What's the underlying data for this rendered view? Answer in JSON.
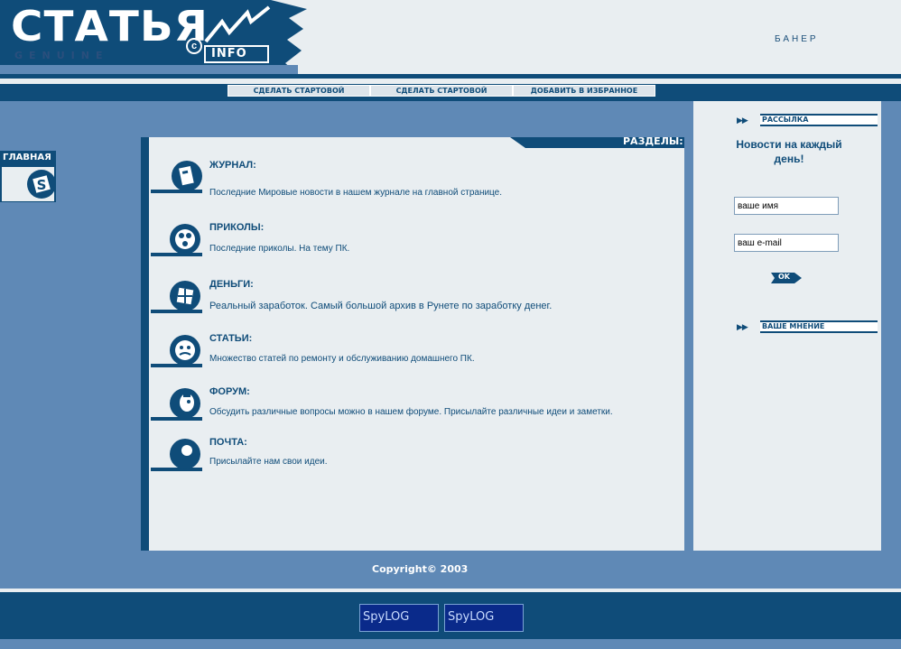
{
  "header": {
    "logo_text": "СТАТЬЯ",
    "logo_subtext": "GENUINE",
    "logo_copyright": "c",
    "logo_info": "INFO",
    "banner": "БАНЕР"
  },
  "nav": {
    "items": [
      {
        "label": "СДЕЛАТЬ СТАРТОВОЙ"
      },
      {
        "label": "СДЕЛАТЬ СТАРТОВОЙ"
      },
      {
        "label": "ДОБАВИТЬ В ИЗБРАННОЕ"
      }
    ]
  },
  "left_menu": {
    "label": "ГЛАВНАЯ",
    "icon": "s-logo-icon"
  },
  "main": {
    "sections_title": "РАЗДЕЛЫ:",
    "sections": [
      {
        "title": "ЖУРНАЛ:",
        "desc": "Последние Мировые новости в нашем журнале на главной странице.",
        "icon": "journal-icon"
      },
      {
        "title": "ПРИКОЛЫ:",
        "desc": "Последние приколы. На тему ПК.",
        "icon": "film-reel-icon"
      },
      {
        "title": "ДЕНЬГИ:",
        "desc": "Реальный заработок. Самый большой архив в Рунете по заработку денег.",
        "icon": "money-icon"
      },
      {
        "title": "СТАТЬИ:",
        "desc": "Множество статей по ремонту и обслуживанию домашнего ПК.",
        "icon": "face-icon"
      },
      {
        "title": "ФОРУМ:",
        "desc": "Обсудить различные вопросы можно в нашем форуме. Присылайте различные идеи и заметки.",
        "icon": "forum-icon"
      },
      {
        "title": "ПОЧТА:",
        "desc": "Присылайте нам свои идеи.",
        "icon": "mail-icon"
      }
    ],
    "copyright": "Copyright© 2003"
  },
  "sidebar": {
    "newsletter_label": "РАССЫЛКА",
    "news_title": "Новости на каждый день!",
    "name_value": "ваше имя",
    "email_value": "ваш e-mail",
    "ok_label": "OK",
    "opinion_label": "ВАШЕ МНЕНИЕ"
  },
  "footer": {
    "counters": [
      {
        "label": "SpyLOG"
      },
      {
        "label": "SpyLOG"
      }
    ]
  },
  "colors": {
    "dark_blue": "#0f4c79",
    "mid_blue": "#5f89b6",
    "light_panel": "#e9eef1"
  }
}
